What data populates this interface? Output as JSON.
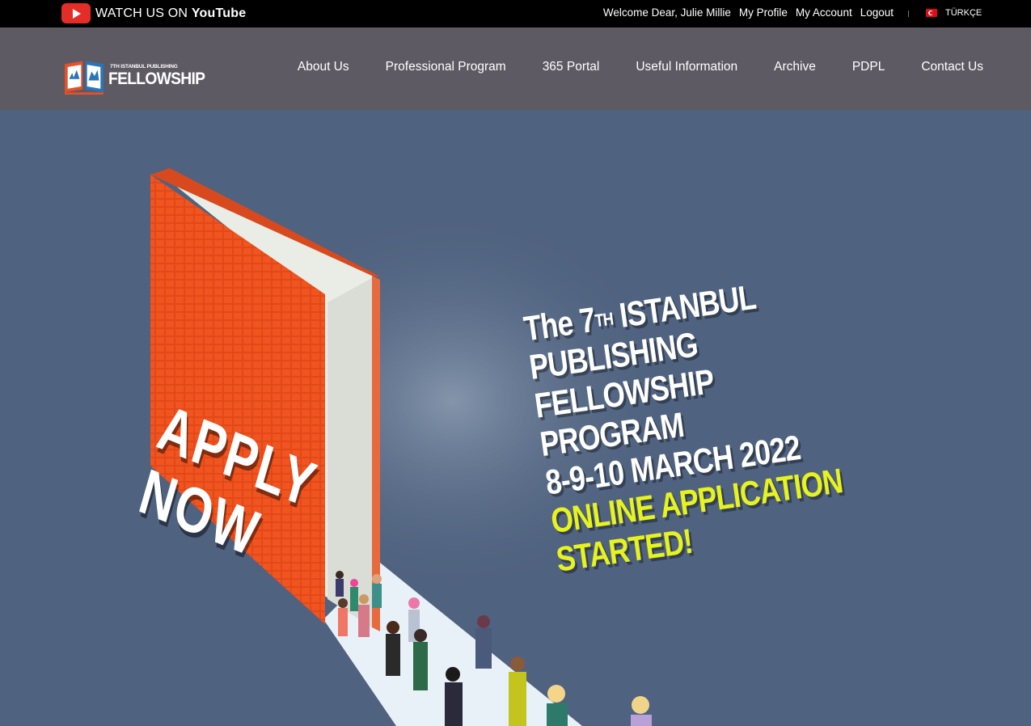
{
  "topbar": {
    "youtube_prefix": "WATCH US ON ",
    "youtube_brand": "YouTube",
    "welcome": "Welcome Dear, Julie Millie",
    "my_profile": "My Profile",
    "my_account": "My Account",
    "logout": "Logout",
    "language": "TÜRKÇE"
  },
  "logo": {
    "small_text": "7TH ISTANBUL PUBLISHING",
    "big_text": "FELLOWSHIP"
  },
  "nav": {
    "items": [
      "About Us",
      "Professional Program",
      "365 Portal",
      "Useful Information",
      "Archive",
      "PDPL",
      "Contact Us"
    ]
  },
  "hero": {
    "apply_line1": "APPLY",
    "apply_line2": "NOW",
    "line1_pre": "The 7",
    "line1_sup": "TH",
    "line1_post": " ISTANBUL",
    "line2": "PUBLISHING",
    "line3": "FELLOWSHIP",
    "line4": "PROGRAM",
    "line5": "8-9-10 MARCH 2022",
    "line6": "ONLINE APPLICATION",
    "line7": "STARTED!"
  },
  "colors": {
    "topbar_bg": "#000000",
    "header_bg": "#5d5a63",
    "hero_bg": "#4f627f",
    "book_orange": "#f0541f",
    "accent_yellow": "#e7f31e",
    "youtube_red": "#e52d27"
  }
}
